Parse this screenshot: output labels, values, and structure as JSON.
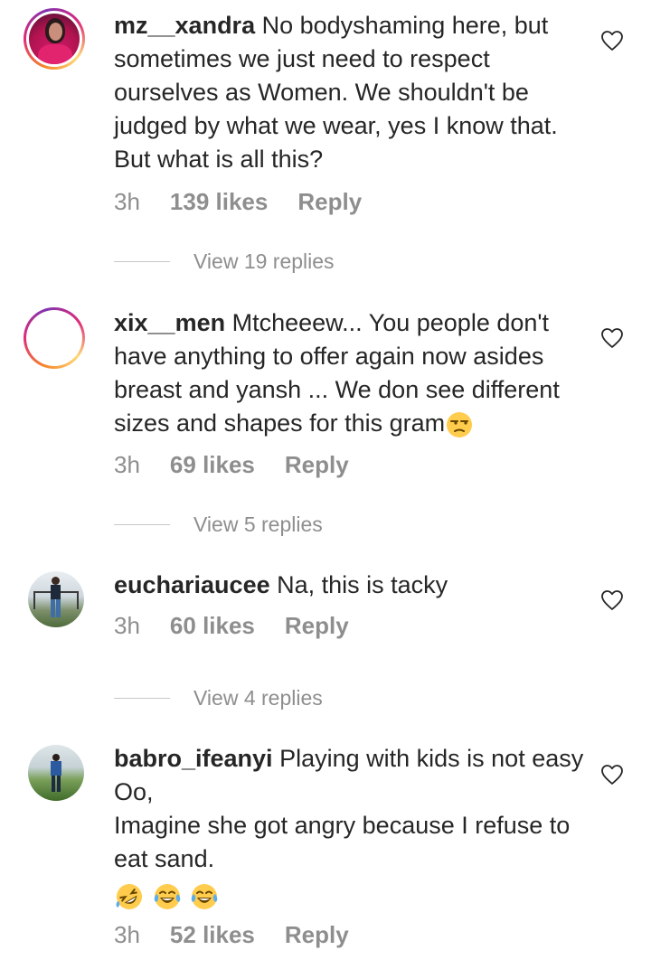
{
  "comments": [
    {
      "username": "mz__xandra",
      "text": "No bodyshaming here, but sometimes we just need to respect ourselves as Women. We shouldn't be judged by what we wear, yes I know that. But what is all this?",
      "time": "3h",
      "likes": "139 likes",
      "reply": "Reply",
      "view_replies": "View 19 replies"
    },
    {
      "username": "xix__men",
      "text": "Mtcheeew... You people don't have anything to offer again now asides breast and yansh ... We don see different sizes and shapes for this gram",
      "time": "3h",
      "likes": "69 likes",
      "reply": "Reply",
      "view_replies": "View 5 replies"
    },
    {
      "username": "euchariaucee",
      "text": "Na, this is tacky",
      "time": "3h",
      "likes": "60 likes",
      "reply": "Reply",
      "view_replies": "View 4 replies"
    },
    {
      "username": "babro_ifeanyi",
      "text_line1": "Playing with kids is not easy Oo,",
      "text_line2": "Imagine she got angry because I refuse to eat sand.",
      "time": "3h",
      "likes": "52 likes",
      "reply": "Reply"
    }
  ],
  "icons": {
    "like": "heart-outline-icon",
    "unamused": "unamused-face-emoji",
    "laughing": "rolling-on-floor-laughing-emoji",
    "tears": "face-with-tears-of-joy-emoji"
  },
  "colors": {
    "text": "#262626",
    "muted": "#8e8e8e",
    "divider": "#c7c7c7"
  }
}
